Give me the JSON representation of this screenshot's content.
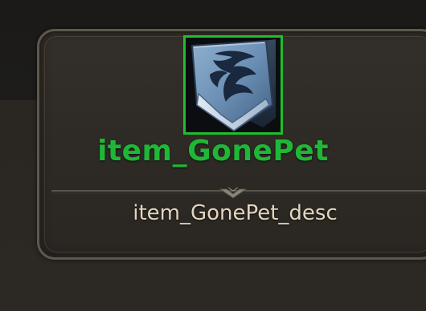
{
  "tooltip": {
    "item_name": "item_GonePet",
    "item_desc": "item_GonePet_desc",
    "rarity_color": "#1fb836",
    "frame_color": "#1fbe2c",
    "text_color": "#e3d5bf",
    "icon": "shield-emblem-icon"
  }
}
